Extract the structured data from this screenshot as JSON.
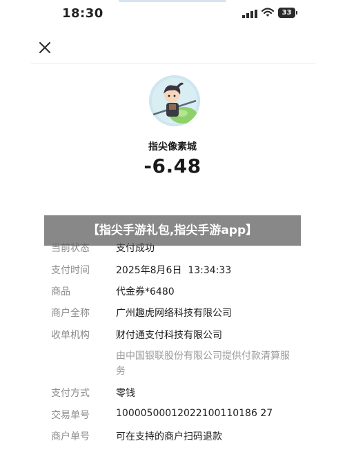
{
  "status_bar": {
    "time": "18:30",
    "battery": "33"
  },
  "merchant": {
    "name": "指尖像素城",
    "amount": "-6.48"
  },
  "banner": {
    "text": "【指尖手游礼包,指尖手游app】"
  },
  "details": {
    "status": {
      "label": "当前状态",
      "value": "支付成功"
    },
    "pay_time": {
      "label": "支付时间",
      "value": "2025年8月6日  13:34:33"
    },
    "goods": {
      "label": "商品",
      "value": "代金券*6480"
    },
    "merchant_full": {
      "label": "商户全称",
      "value": "广州趣虎网络科技有限公司"
    },
    "acquirer": {
      "label": "收单机构",
      "value": "财付通支付科技有限公司",
      "note": "由中国银联股份有限公司提供付款清算服务"
    },
    "pay_method": {
      "label": "支付方式",
      "value": "零钱"
    },
    "trade_no": {
      "label": "交易单号",
      "value": "10000500012022100110186 27"
    },
    "merchant_no": {
      "label": "商户单号",
      "value": "可在支持的商户扫码退款"
    }
  }
}
